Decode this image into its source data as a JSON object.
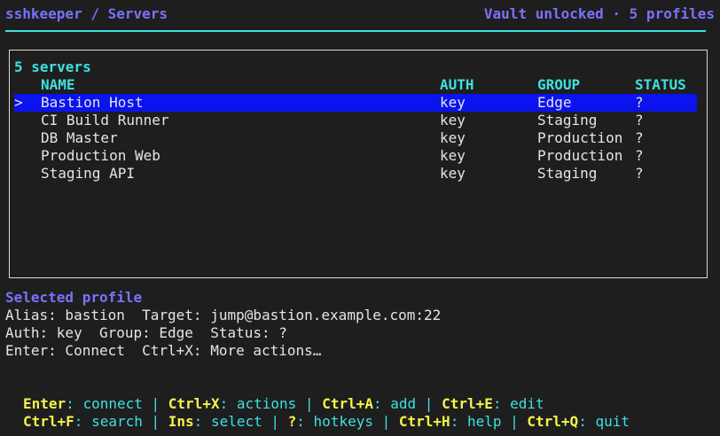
{
  "header": {
    "title": "sshkeeper / Servers",
    "vault_status": "Vault unlocked · 5 profiles"
  },
  "server_list": {
    "count_label": "5 servers",
    "cursor": ">",
    "columns": {
      "name": "NAME",
      "auth": "AUTH",
      "group": "GROUP",
      "status": "STATUS"
    },
    "rows": [
      {
        "name": "Bastion Host",
        "auth": "key",
        "group": "Edge",
        "status": "?",
        "selected": true
      },
      {
        "name": "CI Build Runner",
        "auth": "key",
        "group": "Staging",
        "status": "?",
        "selected": false
      },
      {
        "name": "DB Master",
        "auth": "key",
        "group": "Production",
        "status": "?",
        "selected": false
      },
      {
        "name": "Production Web",
        "auth": "key",
        "group": "Production",
        "status": "?",
        "selected": false
      },
      {
        "name": "Staging API",
        "auth": "key",
        "group": "Staging",
        "status": "?",
        "selected": false
      }
    ]
  },
  "selected_profile": {
    "heading": "Selected profile",
    "line1": "Alias: bastion  Target: jump@bastion.example.com:22",
    "line2": "Auth: key  Group: Edge  Status: ?",
    "line3": "Enter: Connect  Ctrl+X: More actions…"
  },
  "hotkeys": {
    "sep": " | ",
    "line1": [
      {
        "key": "Enter",
        "action": "connect"
      },
      {
        "key": "Ctrl+X",
        "action": "actions"
      },
      {
        "key": "Ctrl+A",
        "action": "add"
      },
      {
        "key": "Ctrl+E",
        "action": "edit"
      }
    ],
    "line2": [
      {
        "key": "Ctrl+F",
        "action": "search"
      },
      {
        "key": "Ins",
        "action": "select"
      },
      {
        "key": "?",
        "action": "hotkeys"
      },
      {
        "key": "Ctrl+H",
        "action": "help"
      },
      {
        "key": "Ctrl+Q",
        "action": "quit"
      }
    ]
  },
  "colors": {
    "background": "#1e1e1e",
    "accent_purple": "#7b72ff",
    "accent_cyan": "#3fe0e0",
    "highlight_blue": "#0b13ee",
    "hotkey_yellow": "#f4f44a"
  }
}
